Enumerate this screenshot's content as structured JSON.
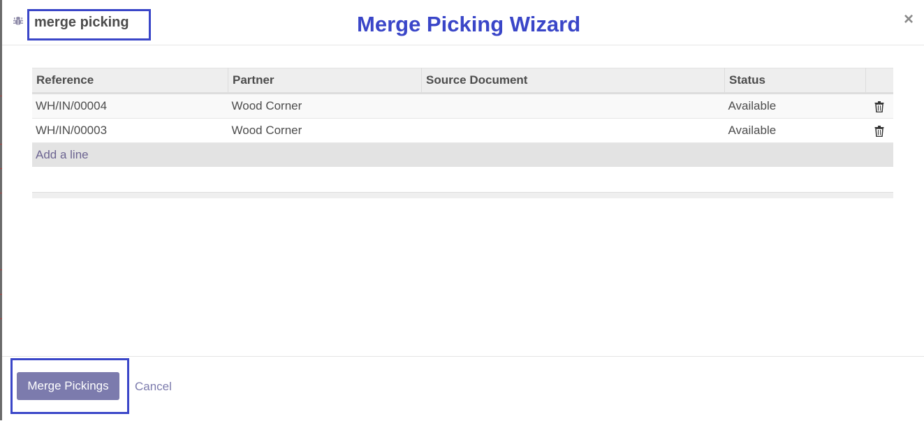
{
  "dialog": {
    "title": "merge picking",
    "overlay_caption": "Merge Picking Wizard",
    "close_symbol": "×"
  },
  "table": {
    "columns": [
      "Reference",
      "Partner",
      "Source Document",
      "Status"
    ],
    "rows": [
      {
        "reference": "WH/IN/00004",
        "partner": "Wood Corner",
        "source_document": "",
        "status": "Available",
        "action_icon": "trash-icon"
      },
      {
        "reference": "WH/IN/00003",
        "partner": "Wood Corner",
        "source_document": "",
        "status": "Available",
        "action_icon": "trash-icon"
      }
    ],
    "add_line": "Add a line"
  },
  "footer": {
    "merge_button": "Merge Pickings",
    "cancel": "Cancel"
  },
  "colors": {
    "highlight": "#3a46c8",
    "primary_button": "#7c7bad",
    "link": "#6c6491"
  },
  "icons": [
    "bug-icon",
    "close-icon",
    "trash-icon"
  ]
}
